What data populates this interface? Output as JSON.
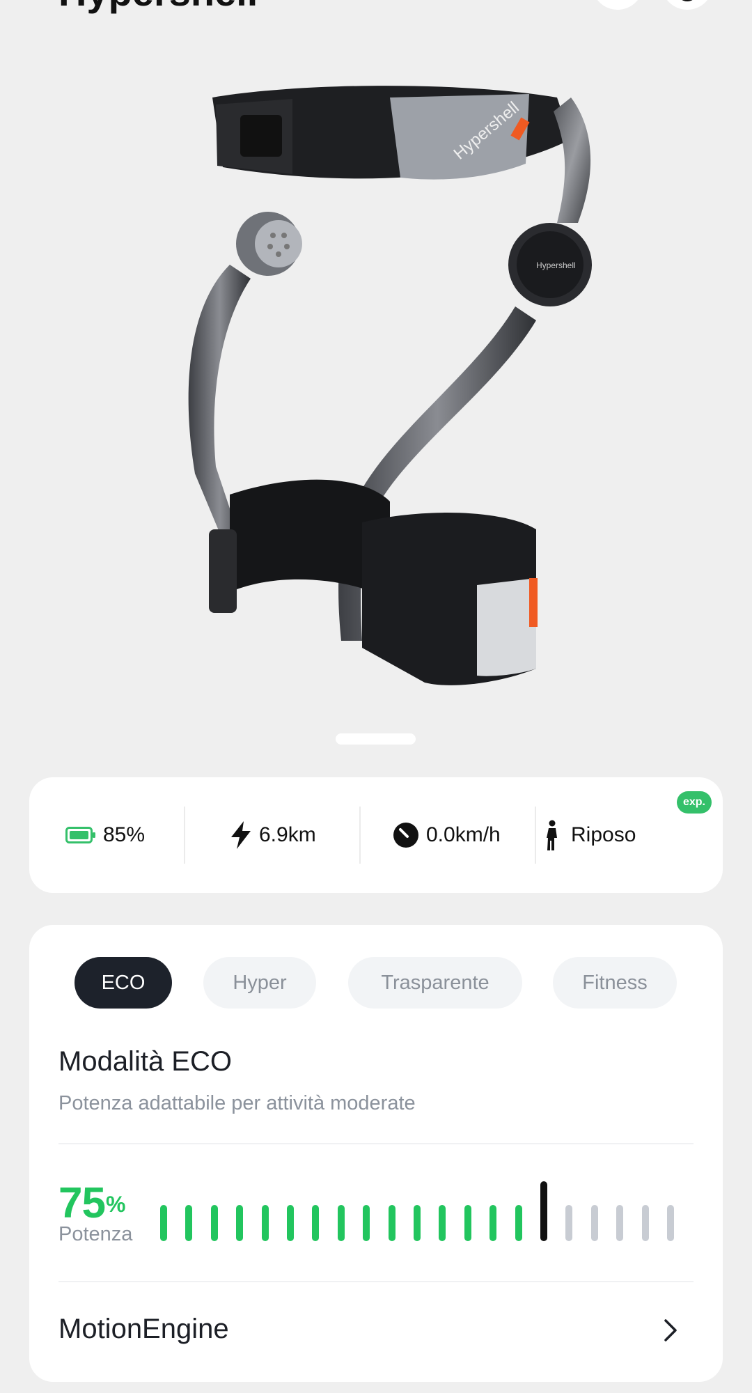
{
  "header": {
    "title_partial": "Hypershell"
  },
  "status": {
    "battery": "85%",
    "range": "6.9km",
    "speed": "0.0km/h",
    "activity": "Riposo",
    "badge": "exp.",
    "battery_color": "#34c06a"
  },
  "modes": {
    "tabs": [
      "ECO",
      "Hyper",
      "Trasparente",
      "Fitness"
    ],
    "active_index": 0,
    "title": "Modalità ECO",
    "subtitle": "Potenza adattabile per attività moderate"
  },
  "power": {
    "value": "75",
    "unit": "%",
    "label": "Potenza",
    "total_levels": 21,
    "active_levels": 15,
    "active_color": "#22c55e",
    "inactive_color": "#c8ccd3",
    "marker_color": "#111111"
  },
  "motion_engine": {
    "label": "MotionEngine"
  },
  "icons": {
    "battery": "battery-icon",
    "range": "lightning-icon",
    "speed": "speedometer-icon",
    "activity": "person-standing-icon",
    "chevron": "chevron-right-icon"
  }
}
